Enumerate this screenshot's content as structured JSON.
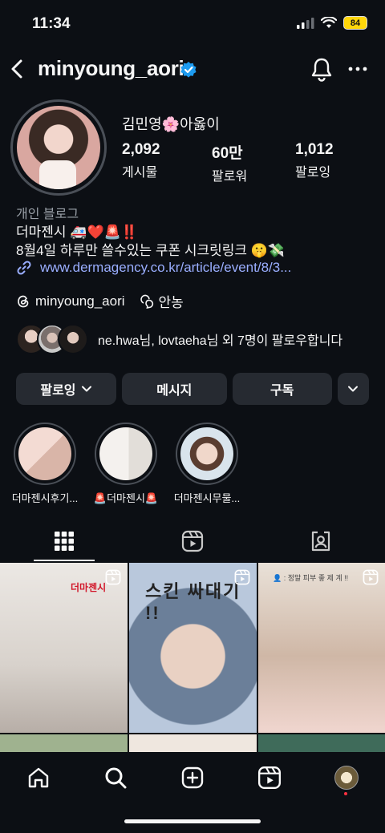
{
  "status_bar": {
    "time": "11:34",
    "battery": "84"
  },
  "header": {
    "username": "minyoung_aori"
  },
  "profile": {
    "display_name": "김민영🌸아옳이",
    "stats": [
      {
        "value": "2,092",
        "label": "게시물"
      },
      {
        "value": "60만",
        "label": "팔로워"
      },
      {
        "value": "1,012",
        "label": "팔로잉"
      }
    ],
    "category": "개인 블로그",
    "bio_line1": "더마젠시 🚑❤️🚨‼️",
    "bio_line2": "8월4일 하루만 쓸수있는 쿠폰 시크릿링크 🤫💸",
    "link": "www.dermagency.co.kr/article/event/8/3...",
    "threads_handle": "minyoung_aori",
    "threads_extra": "안농",
    "followed_by": "ne.hwa님, lovtaeha님 외 7명이 팔로우합니다"
  },
  "actions": {
    "following": "팔로잉",
    "message": "메시지",
    "subscribe": "구독"
  },
  "highlights": [
    {
      "label": "더마젠시후기..."
    },
    {
      "label": "🚨더마젠시🚨"
    },
    {
      "label": "더마젠시무물..."
    }
  ],
  "grid": {
    "post1_title": "더마젠시",
    "post2_title": "스킨 싸대기 !!",
    "post3_caption": "👤 : 정말 피부 좋 제 계 !!"
  },
  "colors": {
    "background": "#0c0f14",
    "link": "#9aaeff",
    "button": "#262a31",
    "verified": "#1d9bf0",
    "notification_dot": "#ff3040"
  }
}
